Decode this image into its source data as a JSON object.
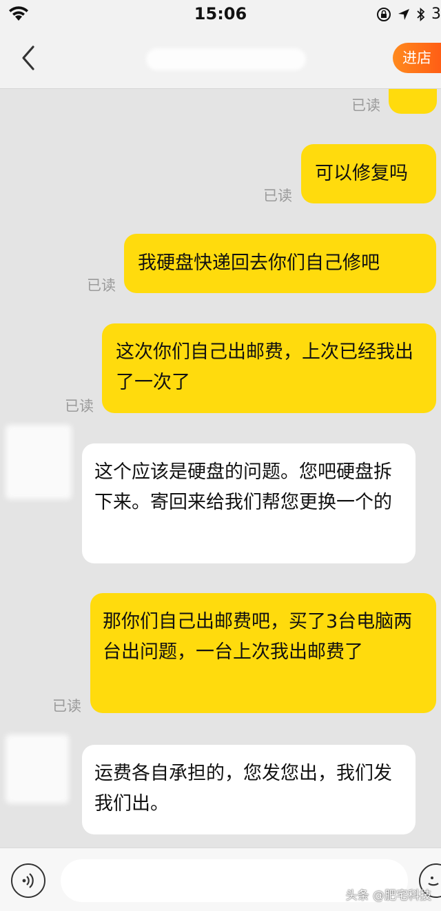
{
  "status_bar": {
    "time": "15:06",
    "battery_text": "3"
  },
  "nav": {
    "enter_shop_label": "进店"
  },
  "messages": [
    {
      "side": "out",
      "text": "",
      "read": "已读"
    },
    {
      "side": "out",
      "text": "可以修复吗",
      "read": "已读"
    },
    {
      "side": "out",
      "text": "我硬盘快递回去你们自己修吧",
      "read": "已读"
    },
    {
      "side": "out",
      "text": "这次你们自己出邮费，上次已经我出了一次了",
      "read": "已读"
    },
    {
      "side": "in",
      "text": "这个应该是硬盘的问题。您吧硬盘拆下来。寄回来给我们帮您更换一个的"
    },
    {
      "side": "out",
      "text": "那你们自己出邮费吧，买了3台电脑两台出问题，一台上次我出邮费了",
      "read": "已读"
    },
    {
      "side": "in",
      "text": "运费各自承担的，您发您出，我们发我们出。"
    }
  ],
  "input": {
    "placeholder": ""
  },
  "watermark": "头条 @肥宅科技",
  "colors": {
    "outgoing_bubble": "#ffdb0d",
    "incoming_bubble": "#ffffff",
    "shop_button": "#ff6a14",
    "chat_background": "#e4e4e4"
  }
}
